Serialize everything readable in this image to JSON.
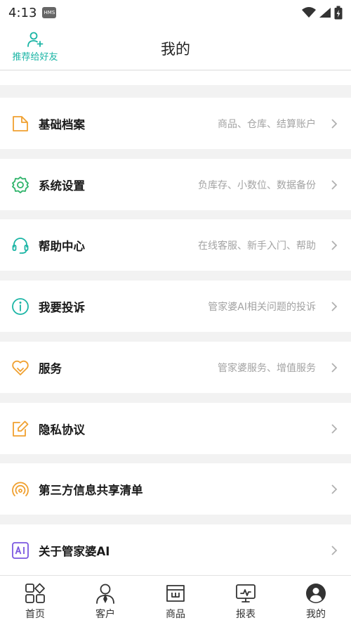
{
  "status_bar": {
    "time": "4:13",
    "badge": "HMS"
  },
  "header": {
    "title": "我的",
    "recommend_label": "推荐给好友"
  },
  "menu": [
    {
      "label": "基础档案",
      "desc": "商品、仓库、结算账户"
    },
    {
      "label": "系统设置",
      "desc": "负库存、小数位、数据备份"
    },
    {
      "label": "帮助中心",
      "desc": "在线客服、新手入门、帮助"
    },
    {
      "label": "我要投诉",
      "desc": "管家婆AI相关问题的投诉"
    },
    {
      "label": "服务",
      "desc": "管家婆服务、增值服务"
    },
    {
      "label": "隐私协议",
      "desc": ""
    },
    {
      "label": "第三方信息共享清单",
      "desc": ""
    },
    {
      "label": "关于管家婆AI",
      "desc": ""
    }
  ],
  "tabs": [
    {
      "label": "首页"
    },
    {
      "label": "客户"
    },
    {
      "label": "商品"
    },
    {
      "label": "报表"
    },
    {
      "label": "我的"
    }
  ],
  "colors": {
    "accent": "#1bb5a5",
    "orange": "#f0a030",
    "green": "#2fb36a",
    "purple": "#7b57e0"
  }
}
